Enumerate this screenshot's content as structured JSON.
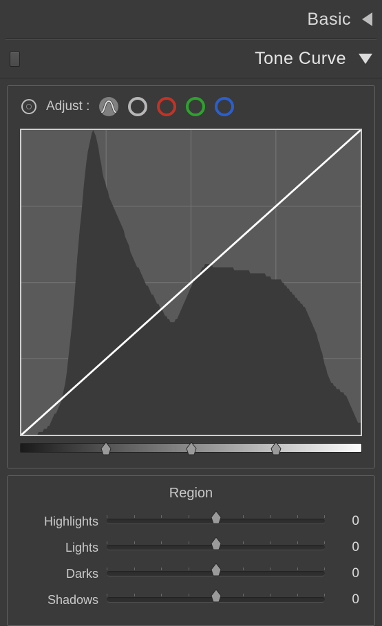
{
  "header": {
    "basic_label": "Basic",
    "tone_curve_label": "Tone Curve"
  },
  "adjust": {
    "label": "Adjust :",
    "channels": {
      "parametric": "parametric",
      "luminance": "luminance",
      "red": "red",
      "green": "green",
      "blue": "blue"
    },
    "colors": {
      "parametric": "#b0b0b0",
      "luminance": "#b7b7b7",
      "red": "#c43226",
      "green": "#2ea22e",
      "blue": "#2a5fd0"
    }
  },
  "curve": {
    "grid_divisions": 4,
    "range_split_positions_pct": [
      25,
      50,
      75
    ]
  },
  "chart_data": {
    "type": "area",
    "title": "Tone Curve",
    "xlabel": "",
    "ylabel": "",
    "xlim": [
      0,
      255
    ],
    "ylim": [
      0,
      1
    ],
    "curve_points": [
      [
        0,
        0
      ],
      [
        255,
        255
      ]
    ],
    "histogram": [
      0.0,
      0.0,
      0.0,
      0.0,
      0.0,
      0.0,
      0.0,
      0.0,
      0.0,
      0.0,
      0.0,
      0.0,
      0.0,
      0.01,
      0.01,
      0.01,
      0.01,
      0.02,
      0.02,
      0.02,
      0.03,
      0.03,
      0.04,
      0.05,
      0.06,
      0.07,
      0.07,
      0.08,
      0.09,
      0.1,
      0.11,
      0.13,
      0.15,
      0.17,
      0.2,
      0.24,
      0.28,
      0.32,
      0.36,
      0.41,
      0.46,
      0.52,
      0.58,
      0.63,
      0.68,
      0.72,
      0.77,
      0.82,
      0.86,
      0.9,
      0.93,
      0.95,
      0.97,
      0.99,
      1.0,
      0.99,
      0.98,
      0.96,
      0.94,
      0.91,
      0.89,
      0.86,
      0.84,
      0.83,
      0.81,
      0.8,
      0.78,
      0.77,
      0.76,
      0.75,
      0.74,
      0.73,
      0.72,
      0.71,
      0.7,
      0.69,
      0.68,
      0.67,
      0.65,
      0.64,
      0.63,
      0.62,
      0.6,
      0.59,
      0.58,
      0.57,
      0.56,
      0.55,
      0.55,
      0.54,
      0.53,
      0.52,
      0.51,
      0.5,
      0.49,
      0.49,
      0.48,
      0.47,
      0.46,
      0.46,
      0.45,
      0.44,
      0.43,
      0.43,
      0.42,
      0.41,
      0.41,
      0.4,
      0.39,
      0.39,
      0.38,
      0.38,
      0.37,
      0.37,
      0.37,
      0.37,
      0.38,
      0.38,
      0.39,
      0.4,
      0.41,
      0.42,
      0.43,
      0.44,
      0.45,
      0.46,
      0.47,
      0.48,
      0.49,
      0.5,
      0.51,
      0.52,
      0.52,
      0.53,
      0.53,
      0.54,
      0.55,
      0.55,
      0.56,
      0.56,
      0.56,
      0.56,
      0.56,
      0.56,
      0.55,
      0.55,
      0.55,
      0.55,
      0.55,
      0.55,
      0.55,
      0.55,
      0.55,
      0.55,
      0.55,
      0.55,
      0.55,
      0.55,
      0.55,
      0.55,
      0.54,
      0.54,
      0.54,
      0.54,
      0.54,
      0.54,
      0.54,
      0.54,
      0.54,
      0.54,
      0.54,
      0.54,
      0.53,
      0.53,
      0.53,
      0.53,
      0.53,
      0.53,
      0.53,
      0.53,
      0.53,
      0.53,
      0.53,
      0.53,
      0.52,
      0.52,
      0.52,
      0.52,
      0.51,
      0.51,
      0.51,
      0.51,
      0.51,
      0.51,
      0.51,
      0.51,
      0.5,
      0.5,
      0.49,
      0.49,
      0.48,
      0.48,
      0.47,
      0.47,
      0.46,
      0.46,
      0.45,
      0.45,
      0.44,
      0.44,
      0.43,
      0.43,
      0.42,
      0.42,
      0.41,
      0.4,
      0.39,
      0.38,
      0.37,
      0.36,
      0.35,
      0.34,
      0.33,
      0.31,
      0.3,
      0.28,
      0.27,
      0.25,
      0.23,
      0.22,
      0.2,
      0.19,
      0.18,
      0.17,
      0.17,
      0.16,
      0.16,
      0.15,
      0.15,
      0.15,
      0.14,
      0.14,
      0.14,
      0.13,
      0.13,
      0.12,
      0.11,
      0.1,
      0.09,
      0.08,
      0.07,
      0.06,
      0.05,
      0.04,
      0.04,
      0.04
    ]
  },
  "region": {
    "title": "Region",
    "sliders": [
      {
        "label": "Highlights",
        "value": 0,
        "min": -100,
        "max": 100
      },
      {
        "label": "Lights",
        "value": 0,
        "min": -100,
        "max": 100
      },
      {
        "label": "Darks",
        "value": 0,
        "min": -100,
        "max": 100
      },
      {
        "label": "Shadows",
        "value": 0,
        "min": -100,
        "max": 100
      }
    ]
  }
}
